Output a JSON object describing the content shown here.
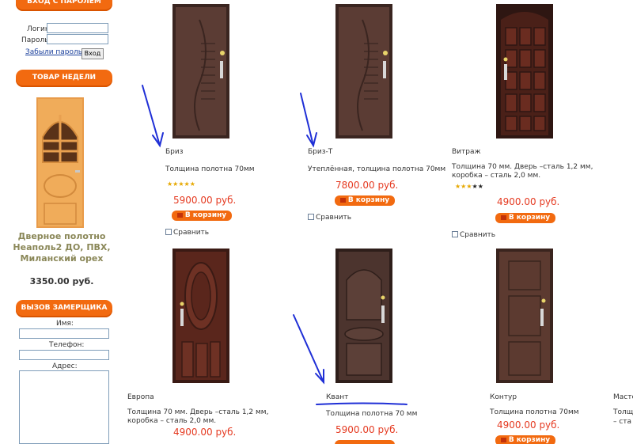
{
  "sidebar": {
    "login_header": "ВХОД С ПАРОЛЕМ",
    "login_label": "Логин:",
    "password_label": "Пароль:",
    "forgot_link": "Забыли пароль?",
    "login_button": "Вход",
    "week_header": "ТОВАР НЕДЕЛИ",
    "week_product_name": "Дверное полотно Неаполь2 ДО, ПВХ, Миланский орех",
    "week_product_price": "3350.00 руб.",
    "call_header": "ВЫЗОВ ЗАМЕРЩИКА",
    "name_label": "Имя:",
    "phone_label": "Телефон:",
    "address_label": "Адрес:"
  },
  "products": [
    {
      "name": "Бриз",
      "desc": "Толщина полотна 70мм",
      "price": "5900.00 руб.",
      "cart": "В корзину",
      "compare": "Сравнить",
      "rating": 5
    },
    {
      "name": "Бриз-Т",
      "desc": "Утеплённая, толщина полотна 70мм",
      "price": "7800.00 руб.",
      "cart": "В корзину",
      "compare": "Сравнить"
    },
    {
      "name": "Витраж",
      "desc": "Толщина 70 мм. Дверь –сталь 1,2 мм, коробка – сталь 2,0 мм.",
      "price": "4900.00 руб.",
      "cart": "В корзину",
      "compare": "Сравнить",
      "rating": 3
    },
    {
      "name": "Европа",
      "desc": "Толщина 70 мм. Дверь –сталь 1,2 мм, коробка – сталь 2,0 мм.",
      "price": "4900.00 руб."
    },
    {
      "name": "Квант",
      "desc": "Толщина полотна 70 мм",
      "price": "5900.00 руб."
    },
    {
      "name": "Контур",
      "desc": "Толщина полотна 70мм",
      "price": "4900.00 руб.",
      "cart": "В корзину"
    },
    {
      "name": "Масте",
      "desc": "Толщ",
      "desc2": "– ста"
    }
  ],
  "colors": {
    "accent": "#f26a10",
    "price": "#e53a21",
    "annotation": "#1f2fd6",
    "door_dark": "#4a2a22"
  }
}
